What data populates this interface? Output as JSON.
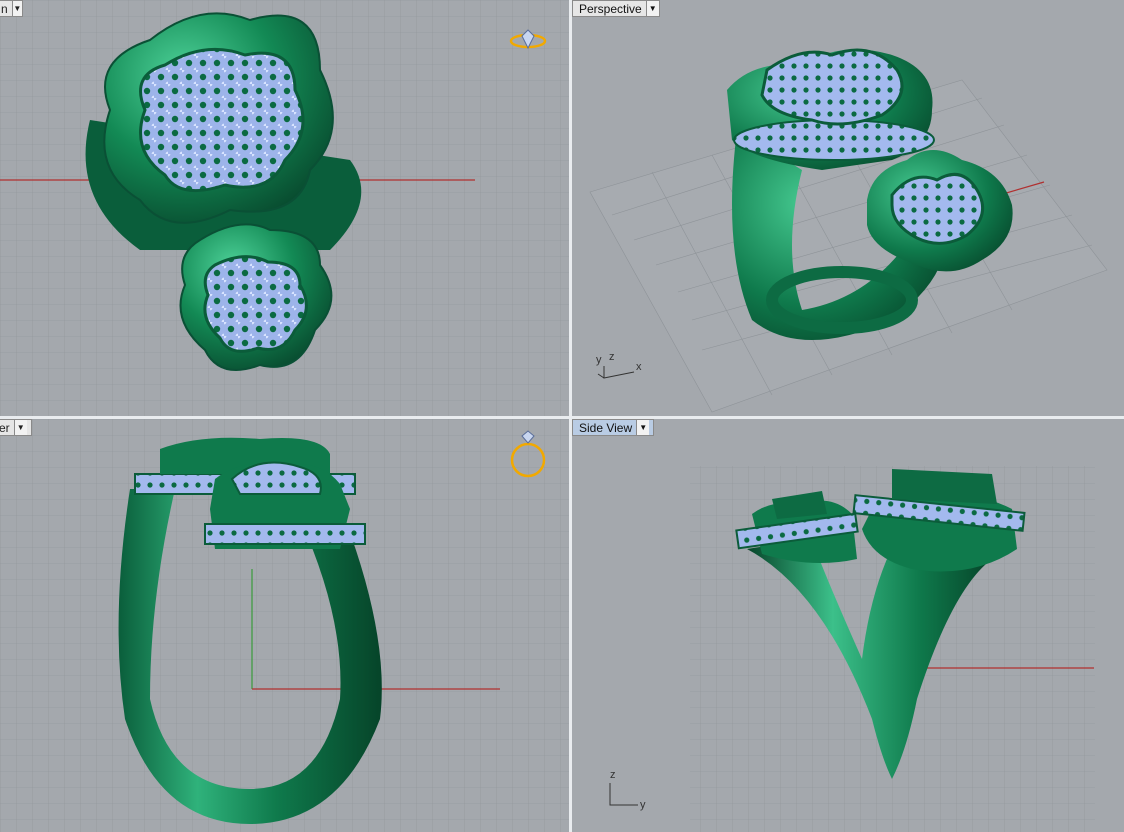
{
  "viewports": {
    "top": {
      "label": "n"
    },
    "perspective": {
      "label": "Perspective"
    },
    "front": {
      "label": "er"
    },
    "side": {
      "label": "Side View"
    }
  },
  "axes": {
    "perspective": {
      "y": "y",
      "z": "z",
      "x": "x"
    },
    "side": {
      "z": "z",
      "y": "y"
    }
  },
  "colors": {
    "metal": "#0f7a4e",
    "metal_light": "#3cc08a",
    "gem": "#a9c0f2",
    "grid_bg": "#a4a8ad",
    "grid_line": "#8e9398",
    "x_axis": "#b03030",
    "y_axis": "#3a9a3a",
    "gumball": "#f2a900"
  }
}
